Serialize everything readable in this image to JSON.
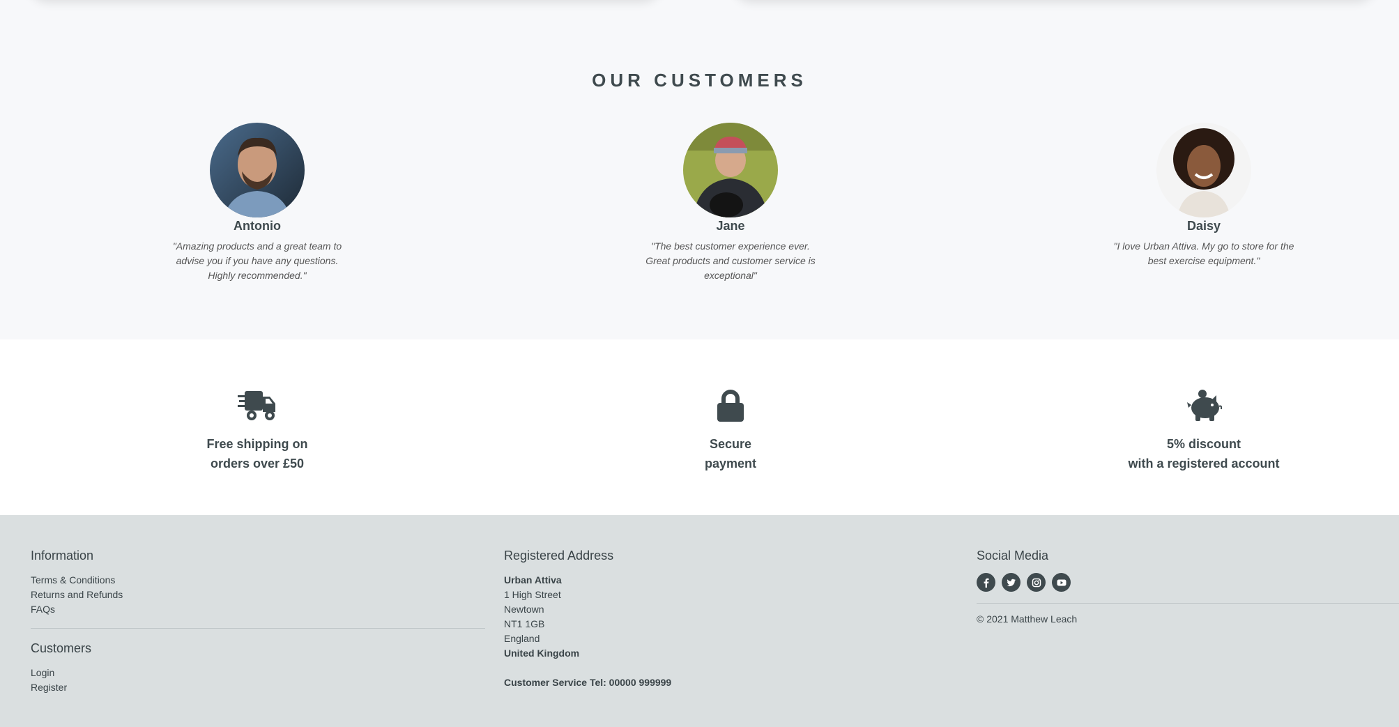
{
  "customers": {
    "title": "OUR CUSTOMERS",
    "items": [
      {
        "name": "Antonio",
        "quote": "\"Amazing products and a great team to advise you if you have any questions. Highly recommended.\""
      },
      {
        "name": "Jane",
        "quote": "\"The best customer experience ever. Great products and customer service is exceptional\""
      },
      {
        "name": "Daisy",
        "quote": "\"I love Urban Attiva. My go to store for the best exercise equipment.\""
      }
    ]
  },
  "features": [
    {
      "icon": "shipping-fast-icon",
      "line1": "Free shipping on",
      "line2": "orders over £50"
    },
    {
      "icon": "lock-icon",
      "line1": "Secure",
      "line2": "payment"
    },
    {
      "icon": "piggy-bank-icon",
      "line1": "5% discount",
      "line2": "with a registered account"
    }
  ],
  "footer": {
    "information": {
      "title": "Information",
      "links": [
        "Terms & Conditions",
        "Returns and Refunds",
        "FAQs"
      ]
    },
    "customers": {
      "title": "Customers",
      "links": [
        "Login",
        "Register"
      ]
    },
    "address": {
      "title": "Registered Address",
      "company": "Urban Attiva",
      "line1": "1 High Street",
      "line2": "Newtown",
      "line3": "NT1 1GB",
      "line4": "England",
      "country": "United Kingdom",
      "tel": "Customer Service Tel: 00000 999999"
    },
    "social": {
      "title": "Social Media",
      "icons": [
        "facebook-icon",
        "twitter-icon",
        "instagram-icon",
        "youtube-icon"
      ],
      "copyright": "© 2021 Matthew Leach"
    }
  },
  "colors": {
    "text": "#3f4a4e",
    "footer_bg": "#dadfe0",
    "section_bg": "#f7f8fa"
  }
}
